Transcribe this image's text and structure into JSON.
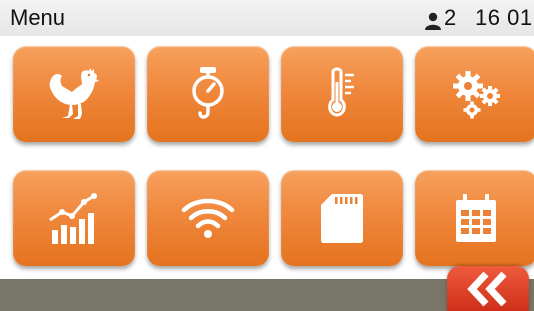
{
  "header": {
    "title": "Menu",
    "user_count": "2",
    "time": "16 01"
  },
  "tiles": [
    {
      "icon": "chicken-icon"
    },
    {
      "icon": "scale-icon"
    },
    {
      "icon": "thermometer-icon"
    },
    {
      "icon": "gears-icon"
    },
    {
      "icon": "growth-chart-icon"
    },
    {
      "icon": "wifi-icon"
    },
    {
      "icon": "sd-card-icon"
    },
    {
      "icon": "calendar-icon"
    }
  ],
  "footer": {
    "back_icon": "double-chevron-left-icon"
  },
  "colors": {
    "tile": "#f0883d",
    "back_button": "#d93a22",
    "bottom_bar": "#777669",
    "status_bar": "#ececec"
  }
}
